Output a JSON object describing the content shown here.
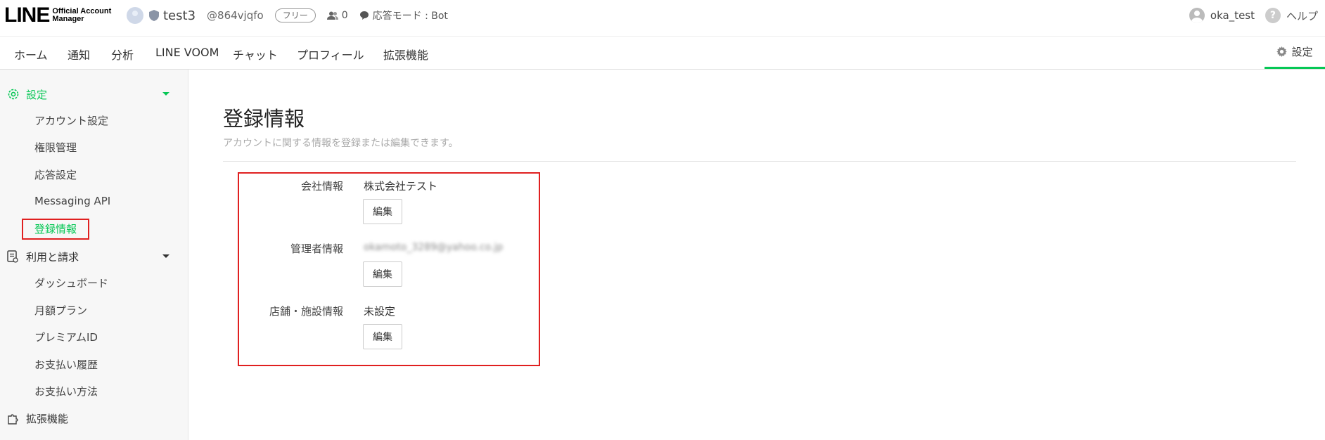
{
  "header": {
    "logo_main": "LINE",
    "logo_sub_1": "Official Account",
    "logo_sub_2": "Manager",
    "account_name": "test3",
    "account_id": "@864vjqfo",
    "plan_badge": "フリー",
    "friends_count": "0",
    "response_mode": "応答モード : Bot",
    "user_name": "oka_test",
    "help_label": "ヘルプ"
  },
  "nav": {
    "items": [
      "ホーム",
      "通知",
      "分析",
      "LINE VOOM",
      "チャット",
      "プロフィール",
      "拡張機能"
    ],
    "settings_label": "設定"
  },
  "sidebar": {
    "settings_group": "設定",
    "settings_items": [
      "アカウント設定",
      "権限管理",
      "応答設定",
      "Messaging API",
      "登録情報"
    ],
    "billing_group": "利用と請求",
    "billing_items": [
      "ダッシュボード",
      "月額プラン",
      "プレミアムID",
      "お支払い履歴",
      "お支払い方法"
    ],
    "extensions_group": "拡張機能"
  },
  "main": {
    "title": "登録情報",
    "description": "アカウントに関する情報を登録または編集できます。",
    "rows": [
      {
        "label": "会社情報",
        "value": "株式会社テスト",
        "button": "編集"
      },
      {
        "label": "管理者情報",
        "value": "okamoto_3289@yahoo.co.jp",
        "button": "編集"
      },
      {
        "label": "店舗・施設情報",
        "value": "未設定",
        "button": "編集"
      }
    ]
  },
  "colors": {
    "accent": "#06c755",
    "highlight": "#e02020"
  }
}
